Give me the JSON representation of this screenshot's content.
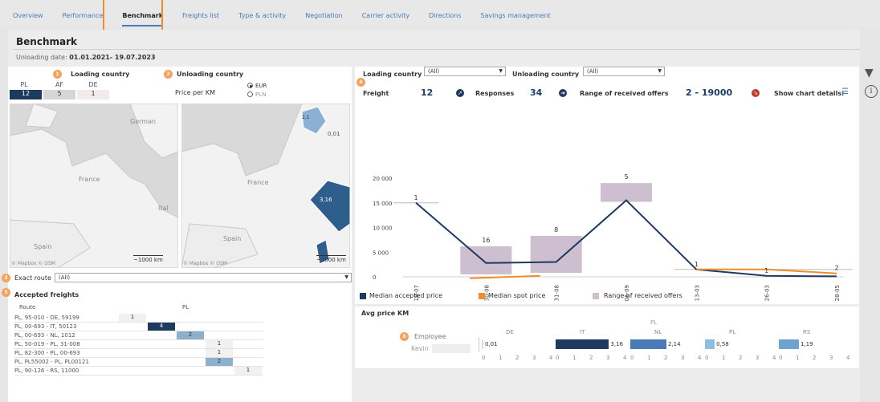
{
  "tabs": [
    "Overview",
    "Performance",
    "Benchmark",
    "Freights list",
    "Type & activity",
    "Negotiation",
    "Carrier activity",
    "Directions",
    "Savings management"
  ],
  "page": {
    "title": "Benchmark",
    "date_label": "Unloading date:",
    "date_value": "01.01.2021- 19.07.2023"
  },
  "left": {
    "badge1": "1",
    "badge2": "2",
    "badge3": "3",
    "badge4": "4",
    "badge5": "5",
    "badge6": "6",
    "loading_country": "Loading country",
    "unloading_country": "Unloading country",
    "country_codes": [
      "PL",
      "AF",
      "DE"
    ],
    "country_counts": [
      "12",
      "5",
      "1"
    ],
    "price_per_km": "Price per KM",
    "currency_options": [
      "EUR",
      "PLN"
    ],
    "map1_labels": [
      "German",
      "France",
      "Ital",
      "Spain"
    ],
    "map2_labels": [
      "France",
      "Spain"
    ],
    "map2_values": [
      "0,01",
      "3,16"
    ],
    "map_value_label": "2,1",
    "attribution": "© Mapbox © OSM",
    "scale": "~1000 km",
    "exact_route_label": "Exact route",
    "exact_route_value": "(All)",
    "accepted_freights": "Accepted freights",
    "route_header": "Route",
    "route_col": "PL",
    "routes": [
      "PL, 95-010 - DE, 59199",
      "PL, 00-693 - IT, 50123",
      "PL, 00-693 - NL, 1012",
      "PL, 50-019 - PL, 31-008",
      "PL, 82-300 - PL, 00-693",
      "PL, PL55002 - PL, PL00121",
      "PL, 90-126 - RS, 11000"
    ],
    "route_values": [
      "1",
      "4",
      "2",
      "1",
      "1",
      "2",
      "1"
    ]
  },
  "right": {
    "loading_country": "Loading country",
    "loading_value": "(All)",
    "unloading_country": "Unloading country",
    "unloading_value": "(All)",
    "freight_label": "Freight",
    "freight_value": "12",
    "responses_label": "Responses",
    "responses_value": "34",
    "range_label": "Range of received offers",
    "range_value": "2 - 19000",
    "details_label": "Show chart details:",
    "legend": [
      "Median accepted price",
      "Median spot price",
      "Range of received offers"
    ],
    "avg_price_title": "Avg price KM",
    "employee_label": "Employee",
    "employee_name": "Kevin",
    "avg_groups": [
      "DE",
      "IT",
      "NL",
      "PL",
      "RS"
    ],
    "avg_values": [
      "0,01",
      "3,16",
      "2,14",
      "0,58",
      "1,19"
    ],
    "avg_extra_top": "PL",
    "avg_ticks": [
      "0",
      "1",
      "2",
      "3",
      "4"
    ]
  },
  "colors": {
    "accepted": "#1f3a5f",
    "spot": "#f28c28",
    "range": "#cdbfcf",
    "accent": "#4a7ab8"
  },
  "chart_data": {
    "type": "line",
    "categories": [
      "18-07",
      "30-08",
      "31-08",
      "06-09",
      "13-03",
      "26-03",
      "28-05"
    ],
    "yticks": [
      "20 000",
      "15 000",
      "10 000",
      "5 000",
      "0"
    ],
    "ylim": [
      0,
      20000
    ],
    "series": [
      {
        "name": "Median accepted price",
        "values": [
          15000,
          2800,
          3000,
          15500,
          1500,
          200,
          100
        ]
      },
      {
        "name": "Median spot price",
        "values": [
          null,
          -300,
          null,
          null,
          1500,
          1500,
          700
        ]
      }
    ],
    "range_boxes": [
      {
        "cat": 1,
        "low": 500,
        "high": 6200,
        "count": "16"
      },
      {
        "cat": 2,
        "low": 800,
        "high": 8300,
        "count": "8"
      },
      {
        "cat": 3,
        "low": 15200,
        "high": 19000,
        "count": "5"
      }
    ],
    "labels": [
      {
        "cat": 0,
        "text": "1"
      },
      {
        "cat": 4,
        "text": "1"
      },
      {
        "cat": 5,
        "text": "1"
      },
      {
        "cat": 6,
        "text": "2"
      }
    ]
  }
}
